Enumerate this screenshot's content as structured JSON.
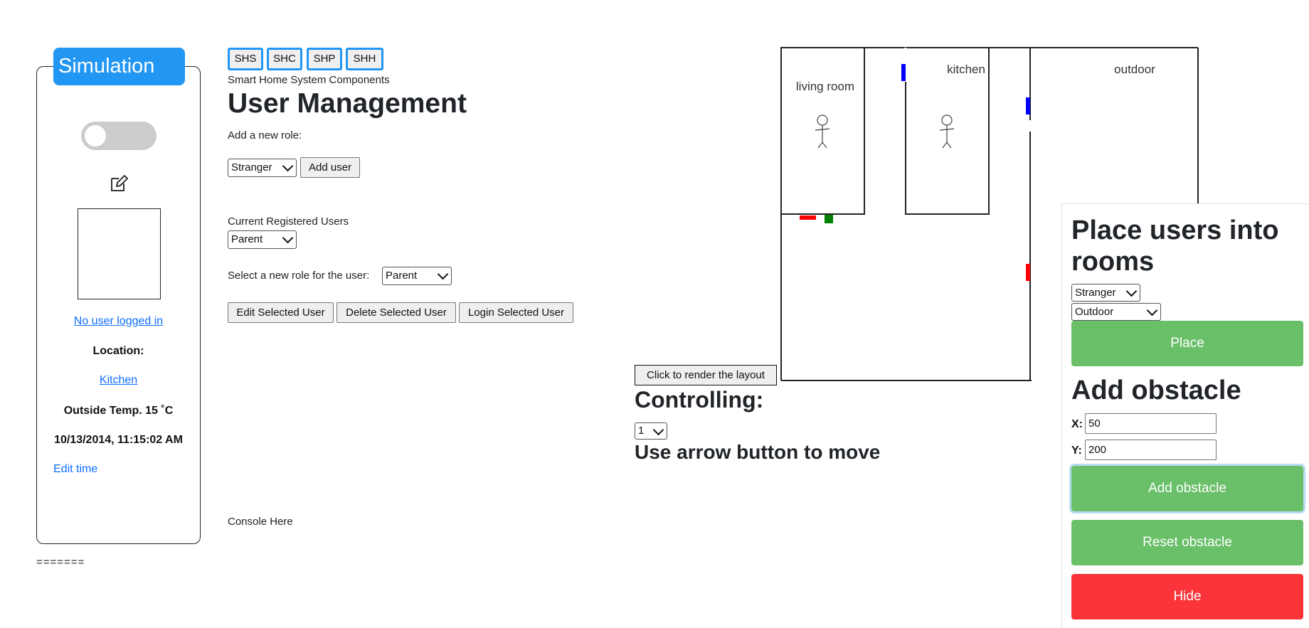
{
  "simulation": {
    "title": "Simulation",
    "user_status": "No user logged in",
    "location_label": "Location:",
    "location_value": "Kitchen",
    "temperature": "Outside Temp. 15 ˚C",
    "datetime": "10/13/2014, 11:15:02 AM",
    "edit_time": "Edit time",
    "separator": "======="
  },
  "tabs": [
    "SHS",
    "SHC",
    "SHP",
    "SHH"
  ],
  "components_label": "Smart Home System Components",
  "user_management": {
    "title": "User Management",
    "add_role_label": "Add a new role:",
    "role_select": "Stranger",
    "add_user_button": "Add user",
    "registered_label": "Current Registered Users",
    "registered_select": "Parent",
    "new_role_label": "Select a new role for the user:",
    "new_role_select": "Parent",
    "edit_button": "Edit Selected User",
    "delete_button": "Delete Selected User",
    "login_button": "Login Selected User",
    "console": "Console Here"
  },
  "layout": {
    "rooms": [
      "living room",
      "kitchen",
      "outdoor"
    ],
    "render_button": "Click to render the layout",
    "controlling_label": "Controlling:",
    "controlling_select": "1",
    "move_hint": "Use arrow button to move",
    "colors": {
      "window": "#0000ff",
      "door": "#ff0000",
      "light": "#008000"
    }
  },
  "place_users": {
    "title": "Place users into rooms",
    "user_select": "Stranger",
    "room_select": "Outdoor",
    "place_button": "Place"
  },
  "obstacle": {
    "title": "Add obstacle",
    "x_label": "X:",
    "x_value": "50",
    "y_label": "Y:",
    "y_value": "200",
    "add_button": "Add obstacle",
    "reset_button": "Reset obstacle",
    "hide_button": "Hide"
  },
  "colors": {
    "accent": "#2196f3",
    "green": "#6abf69",
    "red": "#fa3438"
  }
}
